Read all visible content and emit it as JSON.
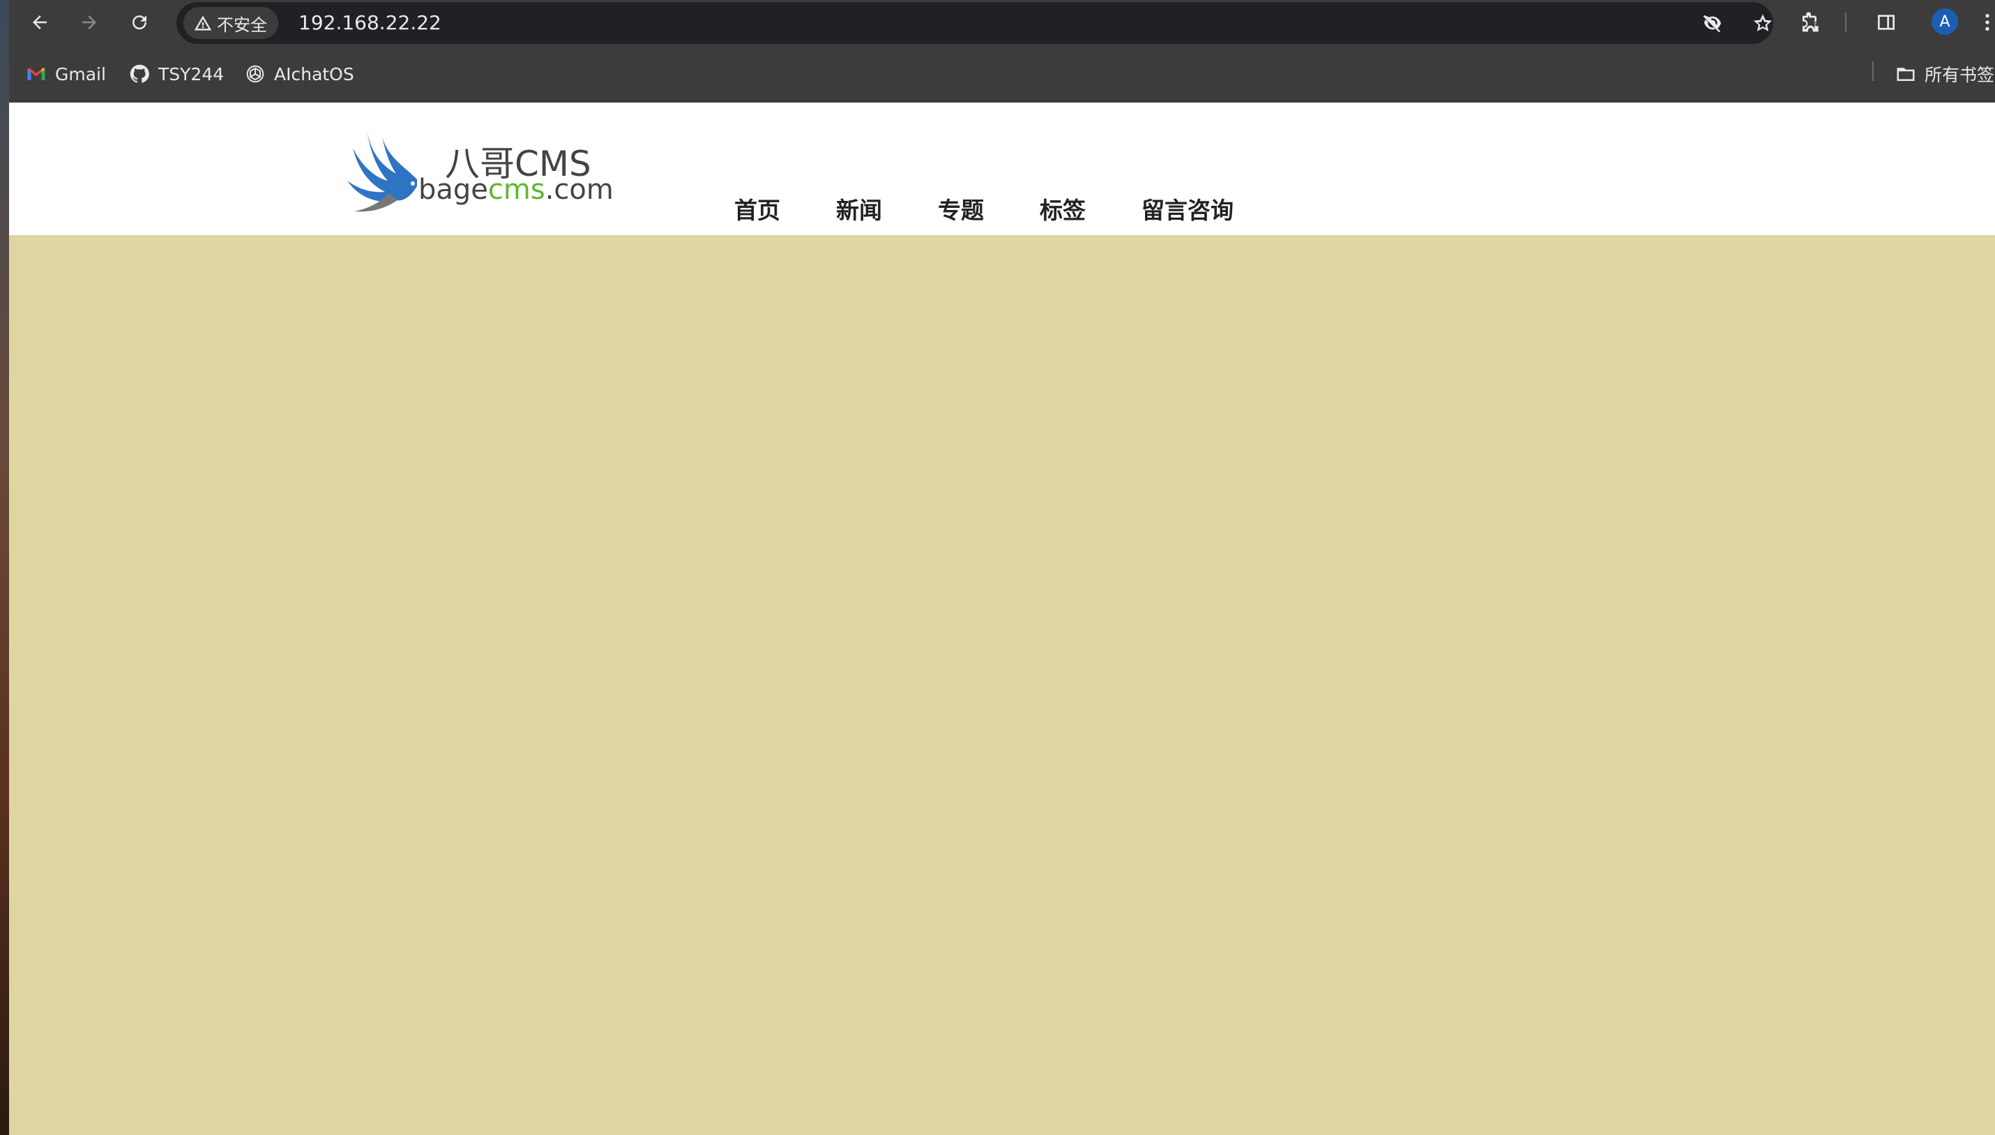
{
  "browser": {
    "security_label": "不安全",
    "url": "192.168.22.22",
    "profile_initial": "A",
    "icons": [
      "back-icon",
      "forward-icon",
      "reload-icon",
      "warning-icon",
      "eye-slash-icon",
      "star-icon",
      "extensions-icon",
      "side-panel-icon",
      "more-icon"
    ]
  },
  "bookmarks": {
    "items": [
      {
        "label": "Gmail",
        "icon": "gmail-icon"
      },
      {
        "label": "TSY244",
        "icon": "github-icon"
      },
      {
        "label": "AIchatOS",
        "icon": "openai-icon"
      }
    ],
    "all_bookmarks_label": "所有书签"
  },
  "site": {
    "logo_cn": "八哥CMS",
    "logo_en_prefix": "bage",
    "logo_en_accent": "cms",
    "logo_en_suffix": ".com",
    "nav": [
      "首页",
      "新闻",
      "专题",
      "标签",
      "留言咨询"
    ],
    "colors": {
      "body_bg": "#ded5a0",
      "header_bg": "#ffffff",
      "logo_accent": "#5cb82c",
      "logo_bird": "#2f73c4"
    }
  }
}
